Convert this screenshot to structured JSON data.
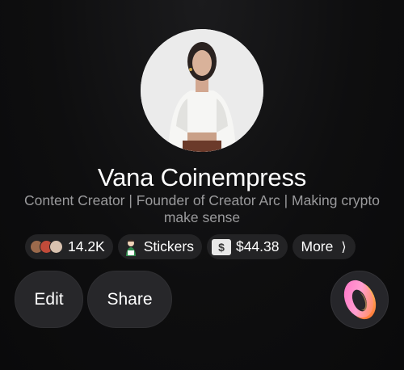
{
  "profile": {
    "name": "Vana Coinempress",
    "bio": "Content Creator | Founder of Creator Arc | Making crypto make sense"
  },
  "chips": {
    "followers": {
      "count": "14.2K",
      "icon": "follower-avatars-icon"
    },
    "stickers": {
      "label": "Stickers",
      "icon": "sticker-icon"
    },
    "balance": {
      "value": "$44.38",
      "icon": "dollar-bill-icon",
      "icon_text": "$"
    },
    "more": {
      "label": "More",
      "chevron": "⟩"
    }
  },
  "actions": {
    "edit_label": "Edit",
    "share_label": "Share",
    "ring_icon": "ring-icon"
  },
  "colors": {
    "background": "#0c0c0d",
    "chip": "#232325",
    "button": "#27272a",
    "bio_text": "#9a9a9c",
    "ring_gradient": [
      "#ff6ec7",
      "#ffb35c",
      "#ff8a3d"
    ]
  }
}
